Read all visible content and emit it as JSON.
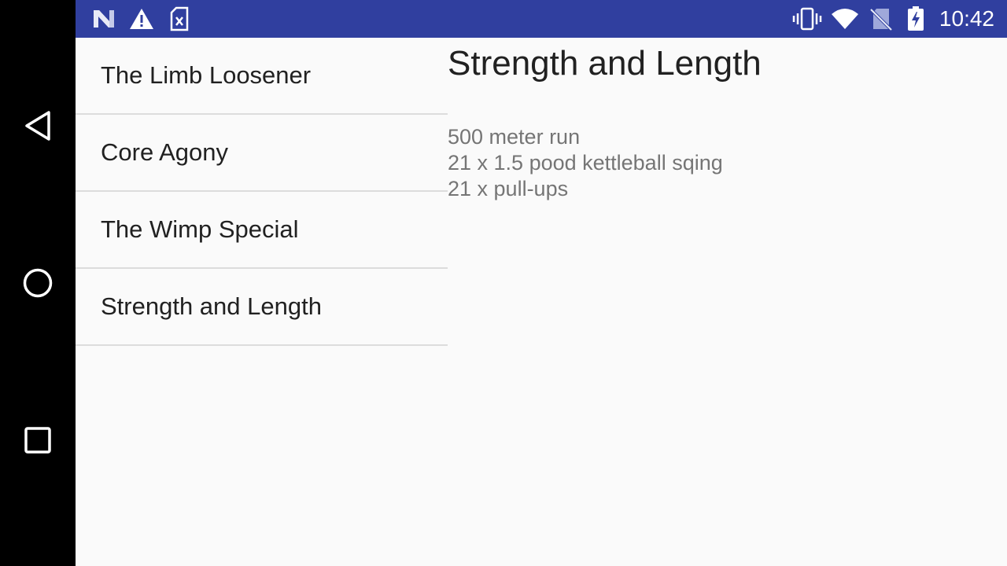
{
  "status_bar": {
    "time": "10:42",
    "left_icons": [
      "n-notification-icon",
      "warning-icon",
      "sim-error-icon"
    ],
    "right_icons": [
      "vibrate-icon",
      "wifi-icon",
      "no-sim-icon",
      "battery-charging-icon"
    ],
    "background": "#303f9f"
  },
  "nav_bar": {
    "buttons": [
      "back-icon",
      "home-icon",
      "recents-icon"
    ]
  },
  "workout_list": {
    "items": [
      {
        "label": "The Limb Loosener"
      },
      {
        "label": "Core Agony"
      },
      {
        "label": "The Wimp Special"
      },
      {
        "label": "Strength and Length"
      }
    ]
  },
  "detail": {
    "title": "Strength and Length",
    "lines": [
      "500 meter run",
      "21 x 1.5 pood kettleball sqing",
      "21 x pull-ups"
    ]
  }
}
